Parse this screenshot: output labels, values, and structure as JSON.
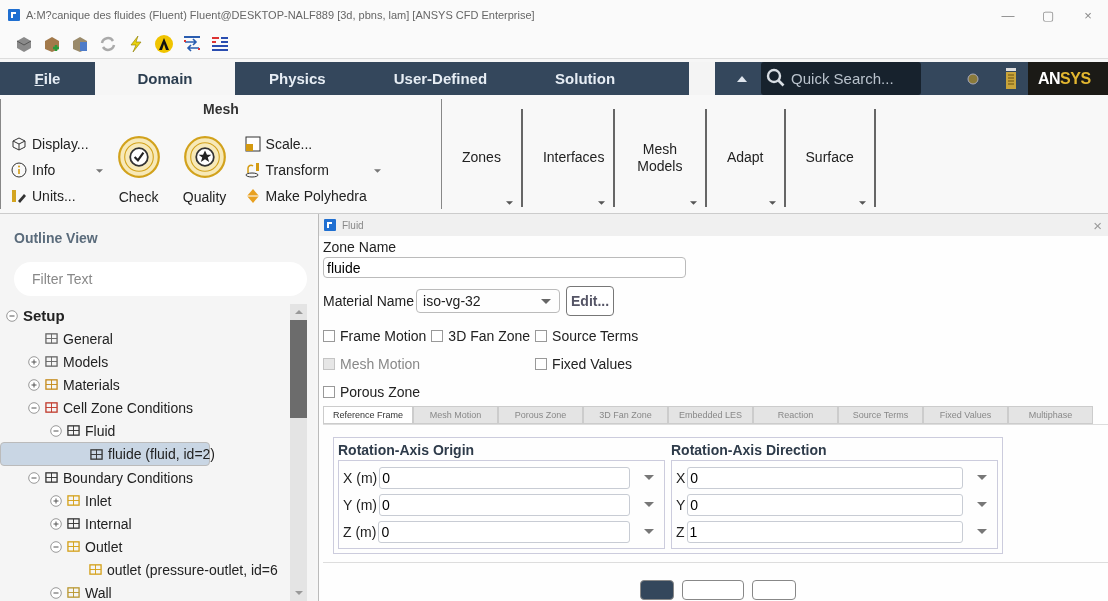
{
  "window": {
    "title": "A:M?canique des fluides (Fluent) Fluent@DESKTOP-NALF889  [3d, pbns, lam] [ANSYS CFD Enterprise]",
    "controls": [
      "—",
      "▢",
      "×"
    ]
  },
  "ribbon_tabs": [
    {
      "label": "File",
      "selected": false
    },
    {
      "label": "Domain",
      "selected": true
    },
    {
      "label": "Physics",
      "selected": false
    },
    {
      "label": "User-Defined",
      "selected": false
    },
    {
      "label": "Solution",
      "selected": false
    }
  ],
  "search": {
    "placeholder": "Quick Search..."
  },
  "logo": [
    "AN",
    "SYS"
  ],
  "ribbon": {
    "mesh_title": "Mesh",
    "left_items": [
      "Display...",
      "Info",
      "Units..."
    ],
    "check": "Check",
    "quality": "Quality",
    "right_items": [
      "Scale...",
      "Transform",
      "Make Polyhedra"
    ],
    "groups": [
      "Zones",
      "Interfaces",
      "Mesh Models",
      "Adapt",
      "Surface"
    ]
  },
  "outline": {
    "title": "Outline View",
    "filter": {
      "placeholder": "Filter Text"
    },
    "tree": [
      {
        "label": "Setup",
        "kind": "root",
        "expanded": true,
        "selected": false,
        "children": [
          {
            "label": "General",
            "kind": "general",
            "selected": false
          },
          {
            "label": "Models",
            "kind": "models",
            "expanded": false,
            "selected": false
          },
          {
            "label": "Materials",
            "kind": "materials",
            "expanded": false,
            "selected": false
          },
          {
            "label": "Cell Zone Conditions",
            "kind": "zones",
            "expanded": true,
            "selected": false,
            "children": [
              {
                "label": "Fluid",
                "kind": "zone",
                "expanded": true,
                "selected": false,
                "children": [
                  {
                    "label": "fluide (fluid, id=2)",
                    "kind": "zone",
                    "selected": true
                  }
                ]
              }
            ]
          },
          {
            "label": "Boundary Conditions",
            "kind": "zone",
            "expanded": true,
            "selected": false,
            "children": [
              {
                "label": "Inlet",
                "kind": "inlet",
                "expanded": false,
                "selected": false
              },
              {
                "label": "Internal",
                "kind": "zone",
                "expanded": false,
                "selected": false
              },
              {
                "label": "Outlet",
                "kind": "outlet",
                "expanded": true,
                "selected": false,
                "children": [
                  {
                    "label": "outlet (pressure-outlet, id=6",
                    "kind": "outlet",
                    "selected": false
                  }
                ]
              },
              {
                "label": "Wall",
                "kind": "wall",
                "expanded": true,
                "selected": false
              }
            ]
          }
        ]
      }
    ]
  },
  "dialog": {
    "title": "Fluid",
    "close": "×",
    "zone_label": "Zone Name",
    "zone_value": "fluide",
    "material_label": "Material Name",
    "material_value": "iso-vg-32",
    "edit_button": "Edit...",
    "option_columns": [
      [
        {
          "label": "Frame Motion",
          "checked": false,
          "disabled": false
        },
        {
          "label": "Mesh Motion",
          "checked": false,
          "disabled": true
        },
        {
          "label": "Porous Zone",
          "checked": false,
          "disabled": false
        }
      ],
      [
        {
          "label": "3D Fan Zone",
          "checked": false,
          "disabled": false
        }
      ],
      [
        {
          "label": "Source Terms",
          "checked": false,
          "disabled": false
        },
        {
          "label": "Fixed Values",
          "checked": false,
          "disabled": false
        }
      ]
    ],
    "tabs": [
      {
        "label": "Reference Frame",
        "selected": true
      },
      {
        "label": "Mesh Motion",
        "selected": false
      },
      {
        "label": "Porous Zone",
        "selected": false
      },
      {
        "label": "3D Fan Zone",
        "selected": false
      },
      {
        "label": "Embedded LES",
        "selected": false
      },
      {
        "label": "Reaction",
        "selected": false
      },
      {
        "label": "Source Terms",
        "selected": false
      },
      {
        "label": "Fixed Values",
        "selected": false
      },
      {
        "label": "Multiphase",
        "selected": false
      }
    ],
    "axis_groups": [
      {
        "title": "Rotation-Axis Origin",
        "rows": [
          {
            "label": "X (m)",
            "value": "0"
          },
          {
            "label": "Y (m)",
            "value": "0"
          },
          {
            "label": "Z (m)",
            "value": "0"
          }
        ]
      },
      {
        "title": "Rotation-Axis Direction",
        "rows": [
          {
            "label": "X",
            "value": "0"
          },
          {
            "label": "Y",
            "value": "0"
          },
          {
            "label": "Z",
            "value": "1"
          }
        ]
      }
    ],
    "footer_buttons": [
      {
        "default": true
      },
      {
        "default": false
      },
      {
        "default": false
      }
    ]
  }
}
